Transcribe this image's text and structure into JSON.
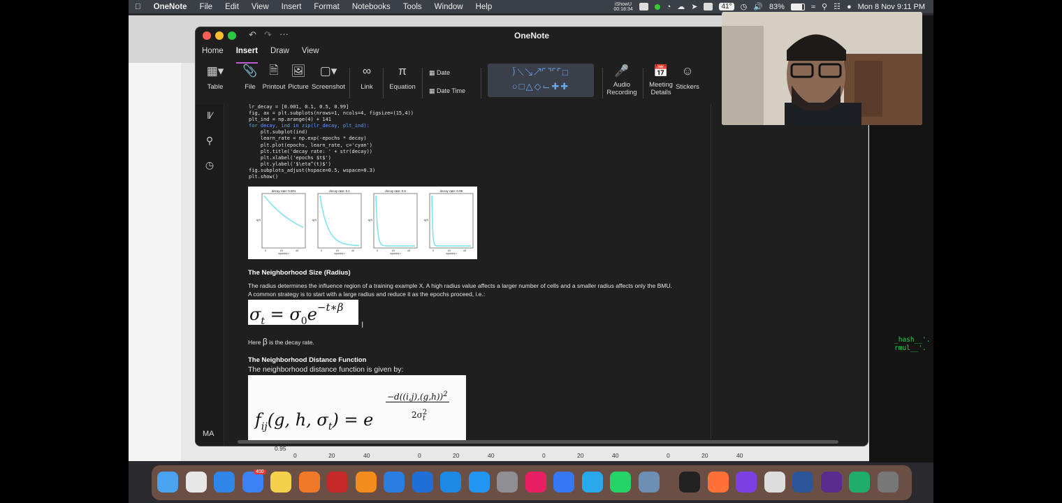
{
  "menubar": {
    "app": "OneNote",
    "items": [
      "File",
      "Edit",
      "View",
      "Insert",
      "Format",
      "Notebooks",
      "Tools",
      "Window",
      "Help"
    ],
    "recorder_label": "iShowU",
    "recorder_time": "00:18:34",
    "temperature": "41°",
    "battery": "83%",
    "datetime": "Mon 8 Nov  9:11 PM"
  },
  "window": {
    "title": "OneNote",
    "tabs": [
      "Home",
      "Insert",
      "Draw",
      "View"
    ],
    "active_tab": "Insert"
  },
  "ribbon": {
    "table": "Table",
    "file": "File",
    "printout": "Printout",
    "picture": "Picture",
    "screenshot": "Screenshot",
    "link": "Link",
    "equation": "Equation",
    "date": "Date",
    "date_time": "Date  Time",
    "audio": "Audio",
    "audio2": "Recording",
    "meeting": "Meeting",
    "meeting2": "Details",
    "stickers": "Stickers"
  },
  "sidebar": {
    "user_initials": "MA"
  },
  "note": {
    "code_lines": [
      "lr_decay = [0.001, 0.1, 0.5, 0.99]",
      "fig, ax = plt.subplots(nrows=1, ncols=4, figsize=(15,4))",
      "plt_ind = np.arange(4) + 141",
      "for decay, ind in zip(lr_decay, plt_ind):",
      "    plt.subplot(ind)",
      "    learn_rate = np.exp(-epochs * decay)",
      "    plt.plot(epochs, learn_rate, c='cyan')",
      "    plt.title('decay rate: ' + str(decay))",
      "    plt.xlabel('epochs $t$')",
      "    plt.ylabel('$\\eta^(t)$')",
      "fig.subplots_adjust(hspace=0.5, wspace=0.3)",
      "plt.show()"
    ],
    "section1_heading": "The Neighborhood Size (Radius)",
    "section1_p1": "The radius determines the influence region of a training example X. A high radius value affects a larger number of cells and a smaller radius affects only the BMU.",
    "section1_p2": "A common strategy is to start with a large radius and reduce it as the epochs proceed, i.e.:",
    "here_prefix": "Here",
    "beta_symbol": "β",
    "here_suffix": "is the decay rate.",
    "section2_heading": "The Neighborhood Distance Function",
    "section2_p1": "The neighborhood distance function is given by:"
  },
  "chart_data": {
    "type": "line",
    "subplots": [
      {
        "title": "decay rate: 0.001",
        "xlabel": "epochs t",
        "ylabel": "η(t)"
      },
      {
        "title": "decay rate: 0.1",
        "xlabel": "epochs t",
        "ylabel": "η(t)"
      },
      {
        "title": "decay rate: 0.5",
        "xlabel": "epochs t",
        "ylabel": "η(t)"
      },
      {
        "title": "decay rate: 0.99",
        "xlabel": "epochs t",
        "ylabel": "η(t)"
      }
    ],
    "x_ticks": [
      "0",
      "20",
      "40"
    ],
    "color": "#00ffff"
  },
  "background_axis": {
    "y_tick": "0.95",
    "x_ticks": [
      "0",
      "20",
      "40",
      "0",
      "20",
      "40",
      "0",
      "20",
      "40",
      "0",
      "20",
      "40"
    ]
  },
  "terminal_snippet": [
    "_hash__'.",
    "rmul__'."
  ],
  "dock_badge": "400"
}
